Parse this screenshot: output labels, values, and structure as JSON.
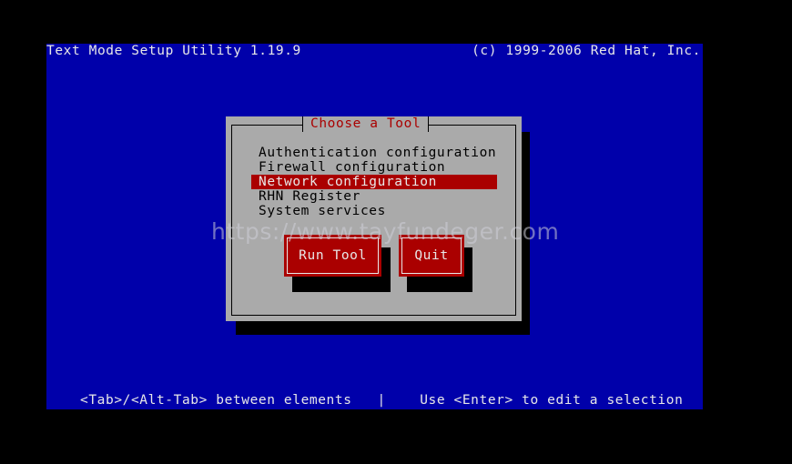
{
  "header": {
    "title": "Text Mode Setup Utility 1.19.9",
    "copyright": "(c) 1999-2006 Red Hat, Inc."
  },
  "dialog": {
    "title": "Choose a Tool",
    "items": [
      {
        "label": "Authentication configuration",
        "selected": false
      },
      {
        "label": "Firewall configuration",
        "selected": false
      },
      {
        "label": "Network configuration",
        "selected": true
      },
      {
        "label": "RHN Register",
        "selected": false
      },
      {
        "label": "System services",
        "selected": false
      }
    ],
    "buttons": {
      "run_tool": "Run Tool",
      "quit": "Quit"
    }
  },
  "status_bar": {
    "text": "<Tab>/<Alt-Tab> between elements   |    Use <Enter> to edit a selection"
  },
  "watermark": {
    "text": "https://www.tayfundeger.com"
  },
  "colors": {
    "background": "#000000",
    "screen": "#0000aa",
    "dialog": "#aaaaaa",
    "accent": "#aa0000",
    "text_light": "#e8e8e8"
  }
}
